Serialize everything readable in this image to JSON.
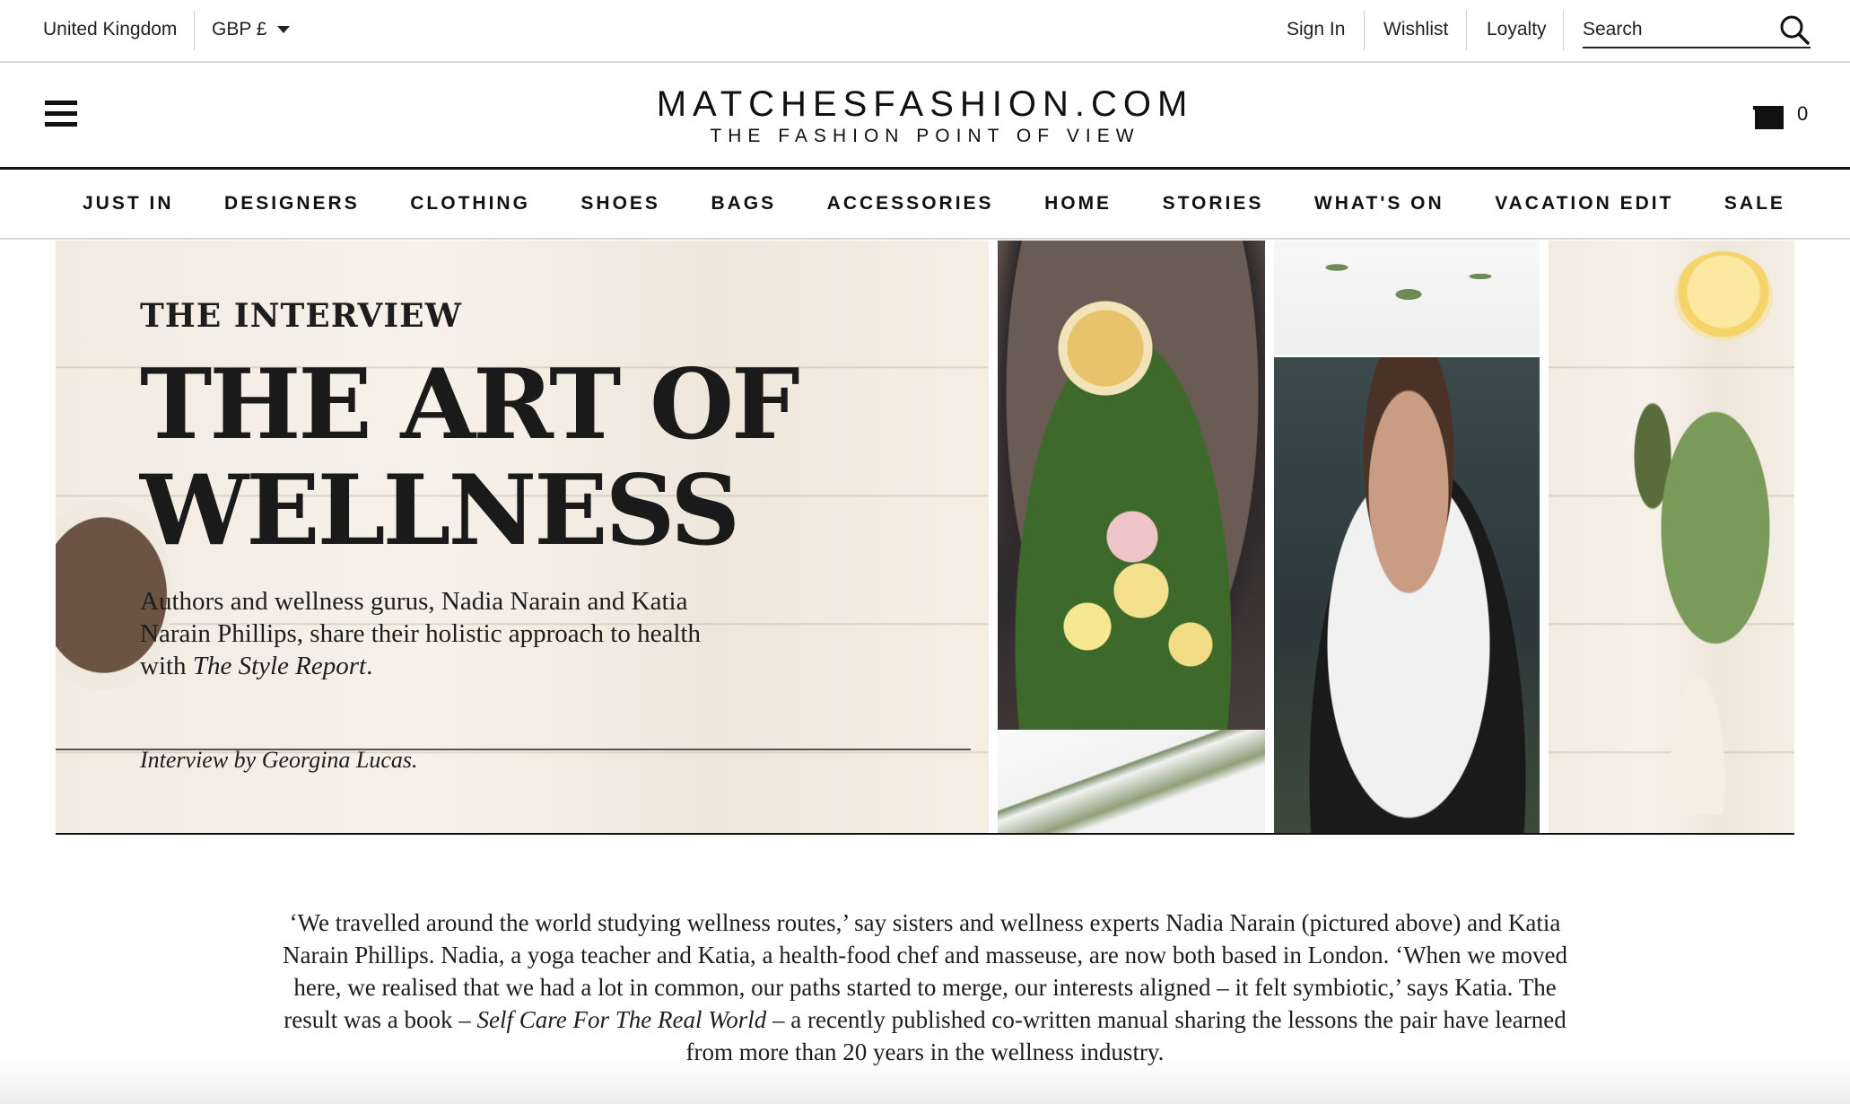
{
  "utility": {
    "region": "United Kingdom",
    "currency": "GBP £",
    "sign_in": "Sign In",
    "wishlist": "Wishlist",
    "loyalty": "Loyalty",
    "search_placeholder": "Search"
  },
  "header": {
    "logo": "MATCHESFASHION.COM",
    "tagline": "THE FASHION POINT OF VIEW",
    "bag_count": "0"
  },
  "nav": {
    "items": [
      "JUST IN",
      "DESIGNERS",
      "CLOTHING",
      "SHOES",
      "BAGS",
      "ACCESSORIES",
      "HOME",
      "STORIES",
      "WHAT'S ON",
      "VACATION EDIT",
      "SALE"
    ]
  },
  "hero": {
    "kicker": "THE INTERVIEW",
    "headline_line1": "THE ART OF",
    "headline_line2": "WELLNESS",
    "standfirst_pre": "Authors and wellness gurus, Nadia Narain and Katia Narain Phillips, share their holistic approach to health with ",
    "standfirst_italic": "The Style Report",
    "standfirst_post": ".",
    "byline": "Interview by Georgina Lucas."
  },
  "article": {
    "intro_pre": "‘We travelled around the world studying wellness routes,’ say sisters and wellness experts Nadia Narain (pictured above) and Katia Narain Phillips. Nadia, a yoga teacher and Katia, a health-food chef and masseuse, are now both based in London. ‘When we moved here, we realised that we had a lot in common, our paths started to merge, our interests aligned – it felt symbiotic,’ says Katia. The result was a book – ",
    "intro_italic": "Self Care For The Real World",
    "intro_post": " – a recently published co-written manual sharing the lessons the pair have learned from more than 20 years in the wellness industry."
  },
  "icons": {
    "dropdown": "caret-down-icon",
    "search": "search-icon",
    "menu": "hamburger-menu-icon",
    "bag": "shopping-bag-icon"
  }
}
